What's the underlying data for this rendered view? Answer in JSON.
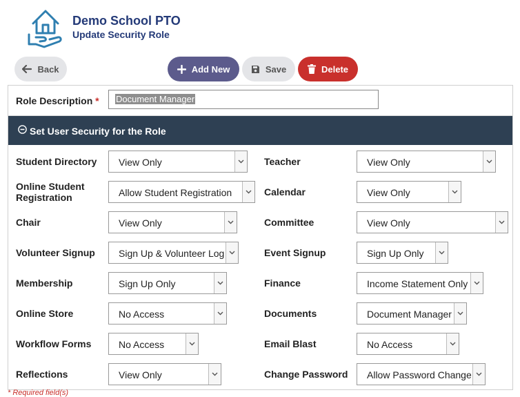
{
  "header": {
    "org_name": "Demo School PTO",
    "page_title": "Update Security Role"
  },
  "toolbar": {
    "back_label": "Back",
    "add_new_label": "Add New",
    "save_label": "Save",
    "delete_label": "Delete"
  },
  "form": {
    "role_description_label": "Role Description",
    "required_marker": "*",
    "role_description_value": "Document Manager",
    "section_title": "Set User Security for the Role",
    "fields": [
      {
        "label": "Student Directory",
        "value": "View Only"
      },
      {
        "label": "Teacher",
        "value": "View Only"
      },
      {
        "label": "Online Student Registration",
        "value": "Allow Student Registration"
      },
      {
        "label": "Calendar",
        "value": "View Only"
      },
      {
        "label": "Chair",
        "value": "View Only"
      },
      {
        "label": "Committee",
        "value": "View Only"
      },
      {
        "label": "Volunteer Signup",
        "value": "Sign Up & Volunteer Log"
      },
      {
        "label": "Event Signup",
        "value": "Sign Up Only"
      },
      {
        "label": "Membership",
        "value": "Sign Up Only"
      },
      {
        "label": "Finance",
        "value": "Income Statement Only"
      },
      {
        "label": "Online Store",
        "value": "No Access"
      },
      {
        "label": "Documents",
        "value": "Document Manager"
      },
      {
        "label": "Workflow Forms",
        "value": "No Access"
      },
      {
        "label": "Email Blast",
        "value": "No Access"
      },
      {
        "label": "Reflections",
        "value": "View Only"
      },
      {
        "label": "Change Password",
        "value": "Allow Password Change"
      }
    ]
  },
  "footer": {
    "required_note": "* Required field(s)"
  },
  "colors": {
    "brand": "#243a78",
    "section_bar": "#2e4053",
    "add_button": "#5c5b8c",
    "delete_button": "#c9302c"
  },
  "icons": {
    "logo": "house-in-hand-icon",
    "back": "arrow-left-icon",
    "add": "plus-icon",
    "save": "floppy-disk-icon",
    "delete": "trash-icon",
    "section": "circle-minus-icon",
    "dropdown": "chevron-down-icon"
  }
}
